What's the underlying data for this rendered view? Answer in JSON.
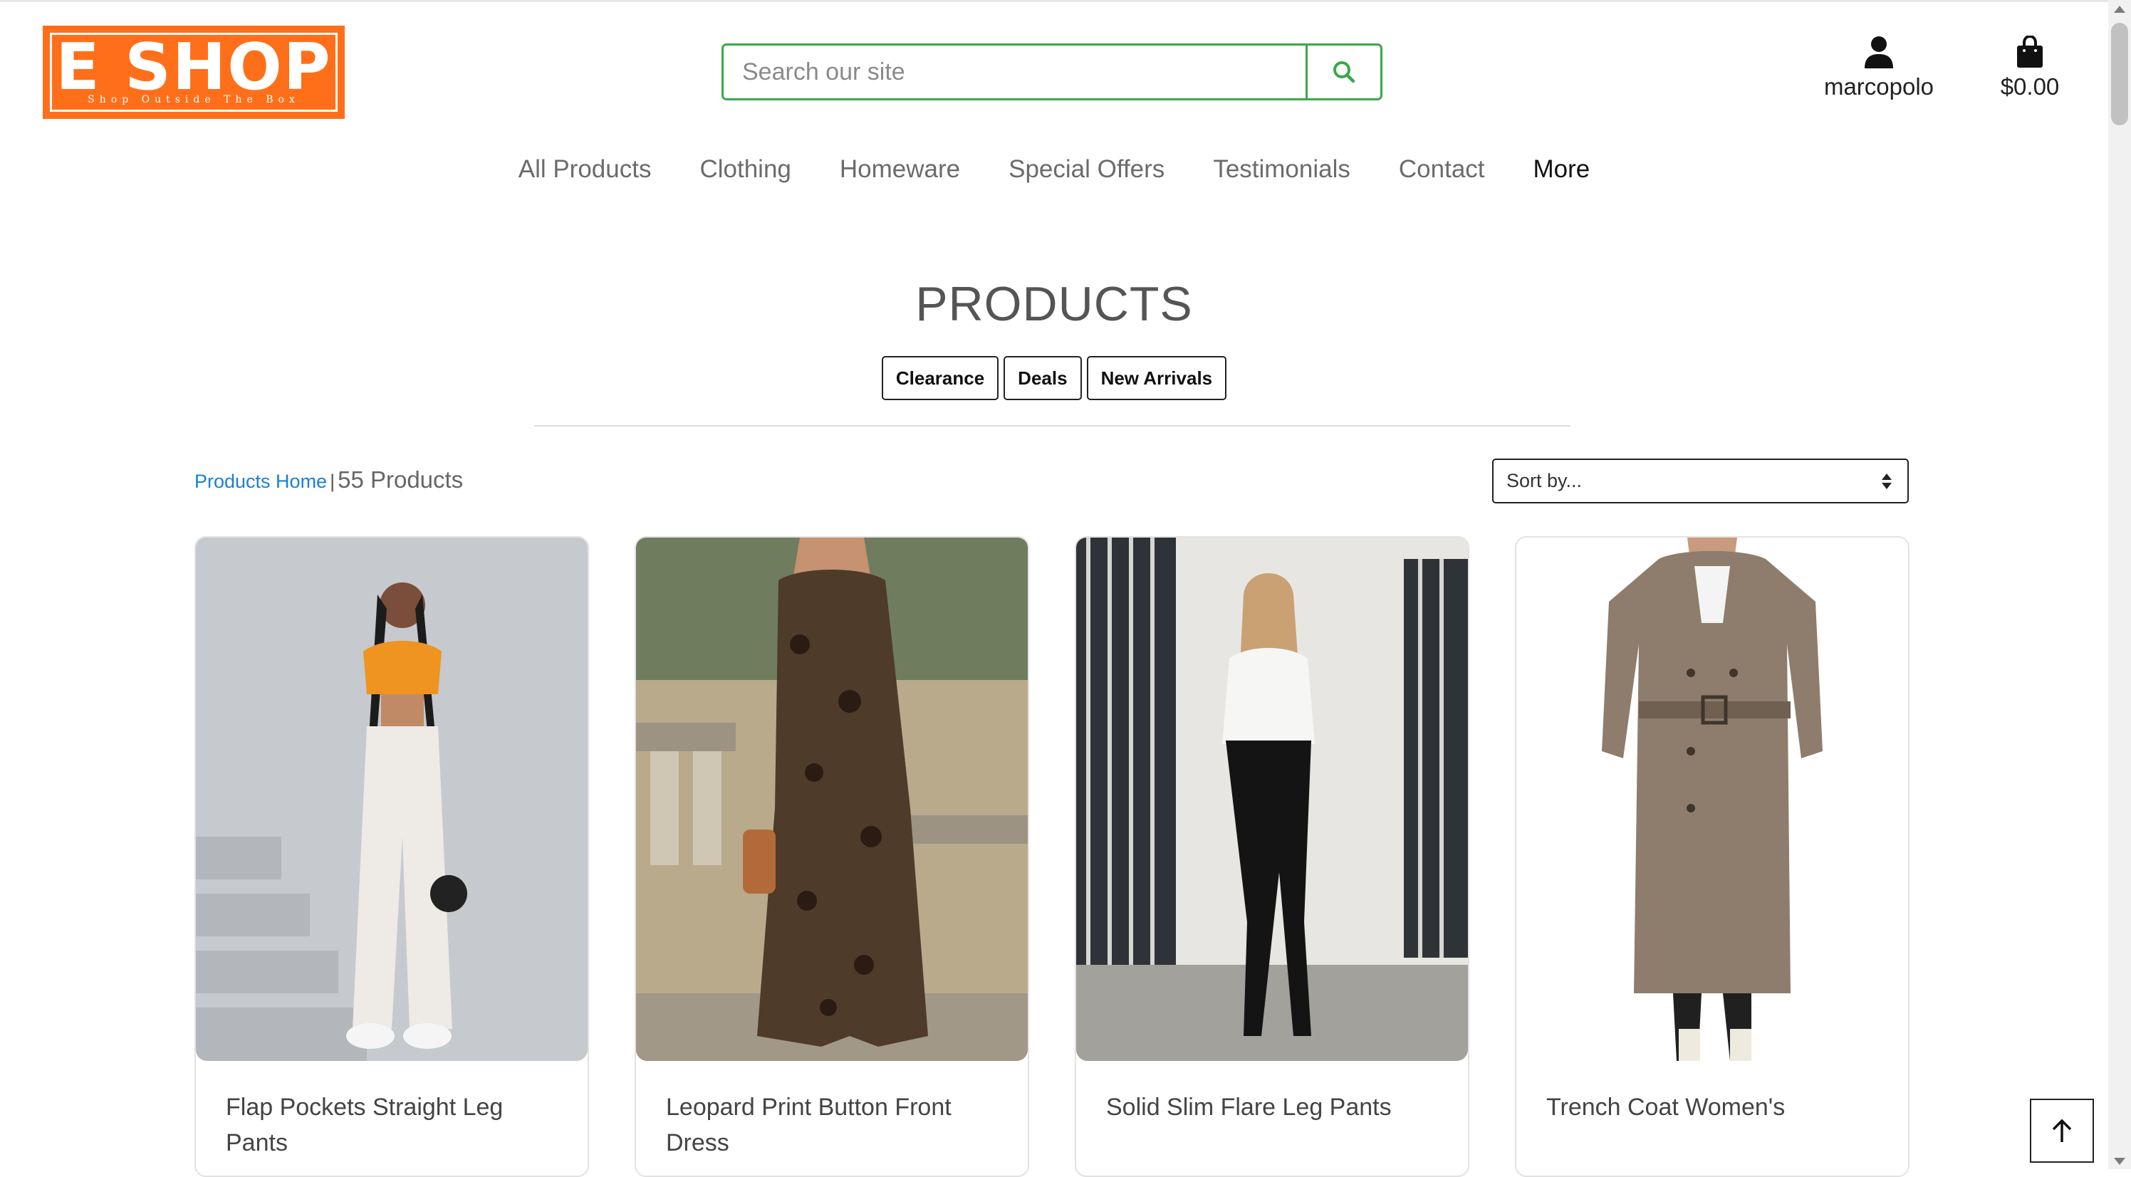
{
  "brand": {
    "title": "E SHOP",
    "tagline": "Shop Outside The Box",
    "color": "#ff6f1a"
  },
  "search": {
    "placeholder": "Search our site",
    "accent": "#3aa84a"
  },
  "account": {
    "label": "marcopolo",
    "icon": "user-icon"
  },
  "bag": {
    "total": "$0.00",
    "icon": "shopping-bag-icon"
  },
  "nav": {
    "items": [
      "All Products",
      "Clothing",
      "Homeware",
      "Special Offers",
      "Testimonials",
      "Contact",
      "More"
    ]
  },
  "page": {
    "heading": "PRODUCTS",
    "filters": [
      "Clearance",
      "Deals",
      "New Arrivals"
    ]
  },
  "breadcrumb": {
    "home": "Products Home",
    "separator": "|",
    "count": "55 Products"
  },
  "sort": {
    "selected": "Sort by..."
  },
  "products": [
    {
      "title": "Flap Pockets Straight Leg Pants"
    },
    {
      "title": "Leopard Print Button Front Dress"
    },
    {
      "title": "Solid Slim Flare Leg Pants"
    },
    {
      "title": "Trench Coat Women's"
    }
  ]
}
